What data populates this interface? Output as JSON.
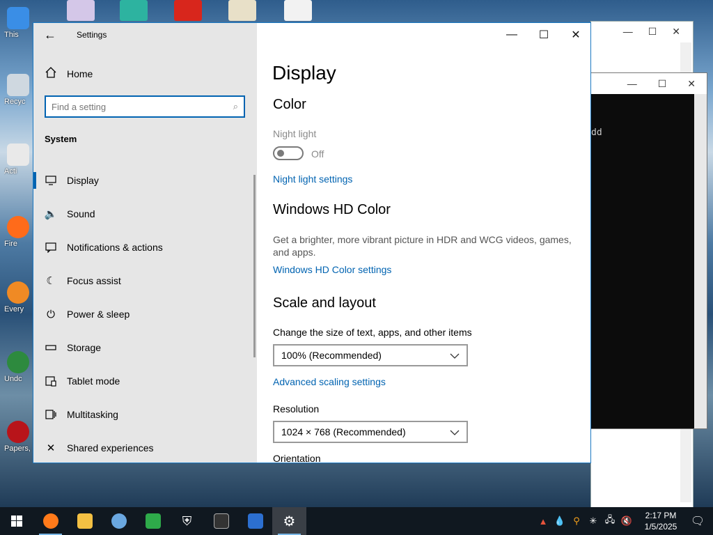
{
  "desktop": {
    "icons": [
      {
        "label": "This",
        "color": "#3a8ee6"
      },
      {
        "label": "Recyc",
        "color": "#cfd8e0"
      },
      {
        "label": "Acti",
        "color": "#e9e9e9"
      },
      {
        "label": "Fire",
        "color": "#ff6b1a"
      },
      {
        "label": "Every",
        "color": "#f08a24"
      },
      {
        "label": "Undc",
        "color": "#2d8a3e"
      },
      {
        "label": "Papers, P",
        "color": "#b8141a"
      }
    ]
  },
  "background_windows": {
    "console_text": "dd"
  },
  "settings": {
    "window_title": "Settings",
    "back_icon": "arrow-left-icon",
    "controls": {
      "minimize": "—",
      "maximize": "☐",
      "close": "✕"
    },
    "nav": {
      "home_label": "Home",
      "search_placeholder": "Find a setting",
      "section_label": "System",
      "items": [
        {
          "label": "Display",
          "icon": "monitor-icon"
        },
        {
          "label": "Sound",
          "icon": "speaker-icon"
        },
        {
          "label": "Notifications & actions",
          "icon": "notification-icon"
        },
        {
          "label": "Focus assist",
          "icon": "moon-icon"
        },
        {
          "label": "Power & sleep",
          "icon": "power-icon"
        },
        {
          "label": "Storage",
          "icon": "storage-icon"
        },
        {
          "label": "Tablet mode",
          "icon": "tablet-icon"
        },
        {
          "label": "Multitasking",
          "icon": "multitasking-icon"
        },
        {
          "label": "Shared experiences",
          "icon": "shared-experiences-icon"
        }
      ]
    },
    "content": {
      "page_title": "Display",
      "color_heading": "Color",
      "night_light_label": "Night light",
      "night_light_state": "Off",
      "night_light_link": "Night light settings",
      "hd_color_heading": "Windows HD Color",
      "hd_color_description": "Get a brighter, more vibrant picture in HDR and WCG videos, games, and apps.",
      "hd_color_link": "Windows HD Color settings",
      "scale_heading": "Scale and layout",
      "scale_label": "Change the size of text, apps, and other items",
      "scale_value": "100% (Recommended)",
      "advanced_scaling_link": "Advanced scaling settings",
      "resolution_label": "Resolution",
      "resolution_value": "1024 × 768 (Recommended)",
      "orientation_label": "Orientation"
    }
  },
  "taskbar": {
    "apps": [
      {
        "name": "firefox",
        "color": "#ff7a1a",
        "running": true
      },
      {
        "name": "file-explorer",
        "color": "#f3c043",
        "running": false
      },
      {
        "name": "people-app",
        "color": "#6aa7e0",
        "running": false
      },
      {
        "name": "green-arrow-app",
        "color": "#2eaa4a",
        "running": false
      },
      {
        "name": "windows-security",
        "color": "#ffffff",
        "running": false
      },
      {
        "name": "command-prompt",
        "color": "#333333",
        "running": false
      },
      {
        "name": "powershell",
        "color": "#2c6fd0",
        "running": false
      },
      {
        "name": "settings",
        "color": "#ffffff",
        "running": true
      }
    ],
    "time": "2:17 PM",
    "date": "1/5/2025"
  },
  "colors": {
    "accent": "#0063b1",
    "nav_bg": "#e6e6e6",
    "taskbar_bg": "#101820"
  }
}
